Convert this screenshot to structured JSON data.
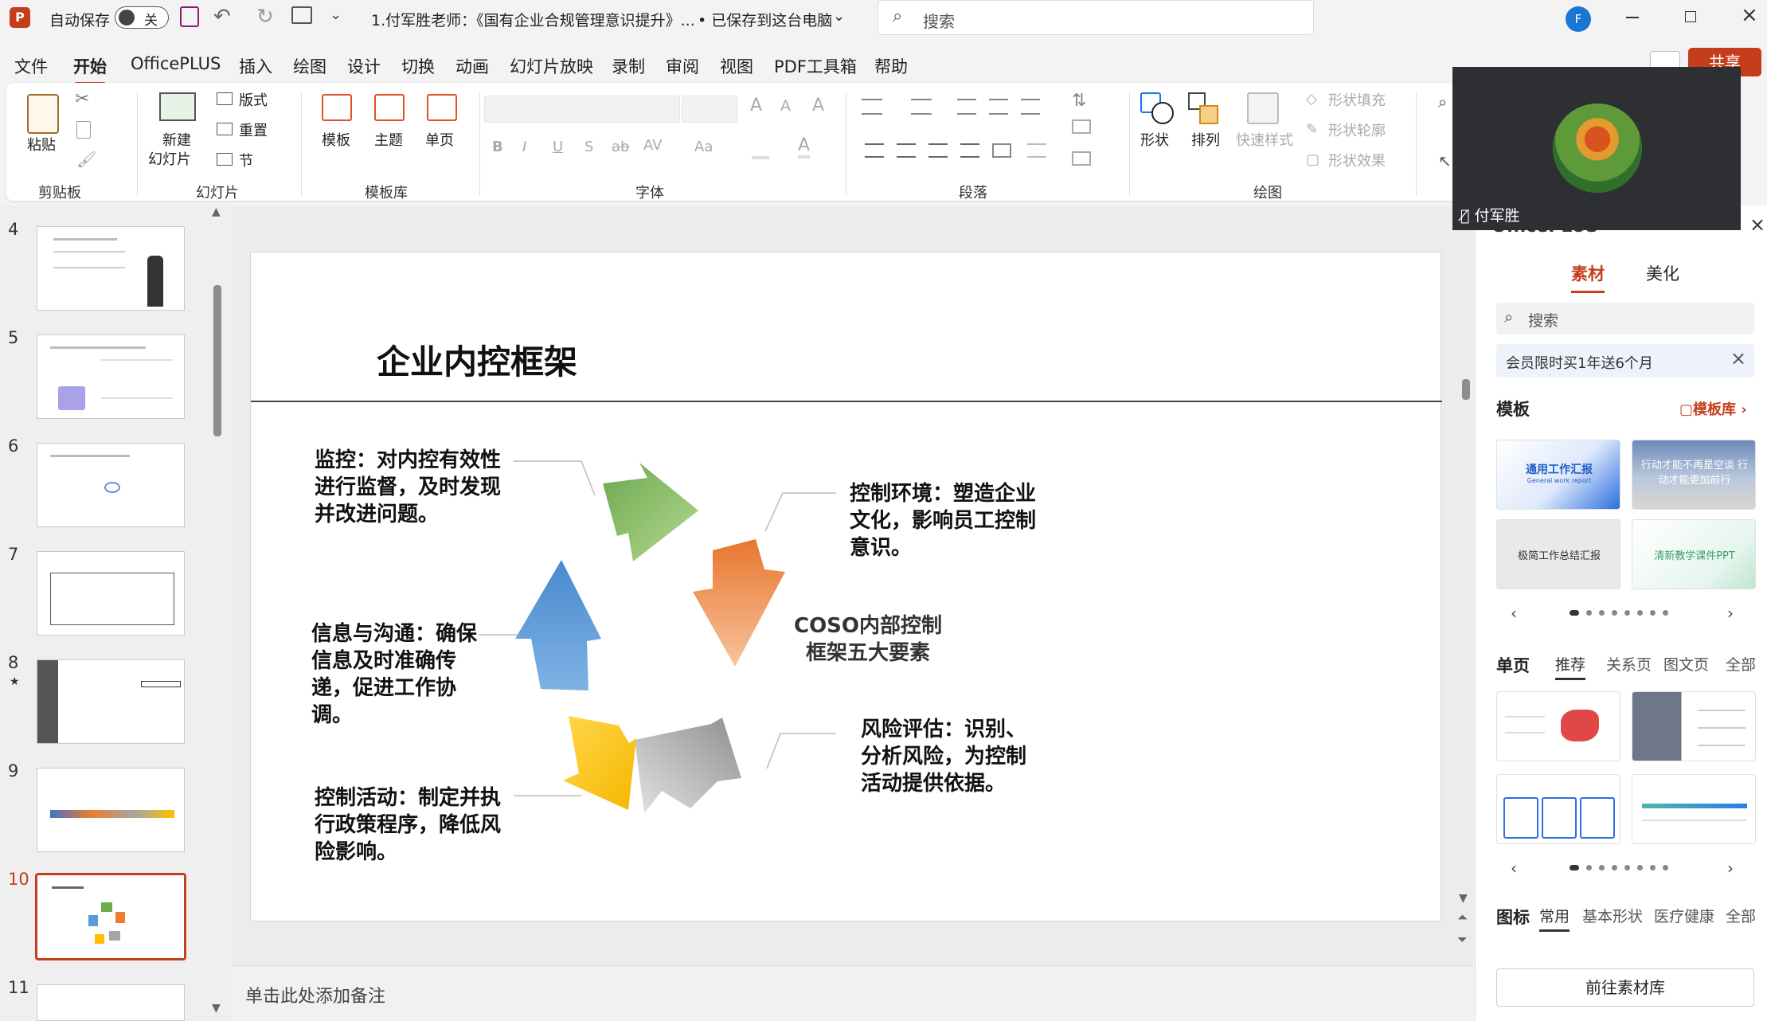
{
  "titlebar": {
    "app_logo": "P",
    "autosave_label": "自动保存",
    "autosave_state": "关",
    "doc_title": "1.付军胜老师：《国有企业合规管理意识提升》...",
    "save_status": "• 已保存到这台电脑",
    "search_placeholder": "搜索",
    "account_initial": "F"
  },
  "menu": {
    "items": [
      "文件",
      "开始",
      "OfficePLUS",
      "插入",
      "绘图",
      "设计",
      "切换",
      "动画",
      "幻灯片放映",
      "录制",
      "审阅",
      "视图",
      "PDF工具箱",
      "帮助"
    ],
    "active": "开始",
    "share_label": "共享"
  },
  "ribbon": {
    "paste": "粘贴",
    "new_slide_1": "新建",
    "new_slide_2": "幻灯片",
    "layout": "版式",
    "reset": "重置",
    "section": "节",
    "template": "模板",
    "theme": "主题",
    "single_page": "单页",
    "shape": "形状",
    "arrange": "排列",
    "quick_style": "快速样式",
    "shape_fill": "形状填充",
    "shape_outline": "形状轮廓",
    "shape_effect": "形状效果",
    "font_btns": [
      "B",
      "I",
      "U",
      "S",
      "ab",
      "AV",
      "Aa"
    ],
    "groups": {
      "clipboard": "剪贴板",
      "slides": "幻灯片",
      "template_lib": "模板库",
      "font": "字体",
      "paragraph": "段落",
      "drawing": "绘图"
    }
  },
  "slides": {
    "numbers": [
      "4",
      "5",
      "6",
      "7",
      "8",
      "9",
      "10",
      "11"
    ],
    "selected": "10",
    "star_mark": "★"
  },
  "slide": {
    "title": "企业内控框架",
    "center_label": "COSO内部控制框架五大要素",
    "center_line1": "COSO内部控制",
    "center_line2": "框架五大要素",
    "elements": {
      "monitor": "监控：对内控有效性进行监督，及时发现并改进问题。",
      "environment": "控制环境：塑造企业文化，影响员工控制意识。",
      "info": "信息与沟通：确保信息及时准确传递，促进工作协调。",
      "risk": "风险评估：识别、分析风险，为控制活动提供依据。",
      "activity": "控制活动：制定并执行政策程序，降低风险影响。"
    },
    "colors": {
      "green": "#70ad47",
      "orange": "#ed7d31",
      "gray": "#a5a5a5",
      "yellow": "#ffc000",
      "blue": "#5b9bd5"
    }
  },
  "notes": {
    "placeholder": "单击此处添加备注"
  },
  "right_panel": {
    "title": "OfficePLUS",
    "tabs": [
      "素材",
      "美化"
    ],
    "active_tab": "素材",
    "search_placeholder": "搜索",
    "promo": "会员限时买1年送6个月",
    "template_heading": "模板",
    "template_lib_link": "模板库",
    "template_cards": [
      {
        "title": "通用工作汇报",
        "subtitle": "General work report"
      },
      {
        "title": "行动才能不再是空谈 行动才能更加前行",
        "subtitle": ""
      },
      {
        "title": "极简工作总结汇报",
        "subtitle": ""
      },
      {
        "title": "清新教学课件PPT",
        "subtitle": ""
      }
    ],
    "single_page_heading": "单页",
    "single_page_tabs": [
      "推荐",
      "关系页",
      "图文页",
      "全部"
    ],
    "icon_heading": "图标",
    "icon_tabs": [
      "常用",
      "基本形状",
      "医疗健康",
      "全部"
    ],
    "goto_lib": "前往素材库"
  },
  "video": {
    "name": "付军胜"
  }
}
